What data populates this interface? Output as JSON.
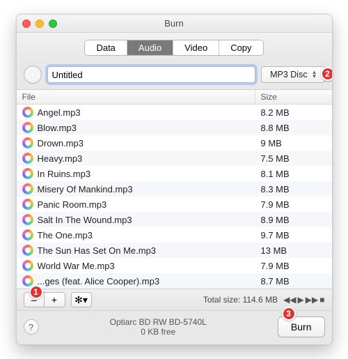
{
  "window": {
    "title": "Burn"
  },
  "tabs": {
    "items": [
      "Data",
      "Audio",
      "Video",
      "Copy"
    ],
    "active_index": 1
  },
  "disc": {
    "name_value": "Untitled",
    "type_label": "MP3 Disc"
  },
  "columns": {
    "file": "File",
    "size": "Size"
  },
  "files": [
    {
      "name": "Angel.mp3",
      "size": "8.2 MB"
    },
    {
      "name": "Blow.mp3",
      "size": "8.8 MB"
    },
    {
      "name": "Drown.mp3",
      "size": "9 MB"
    },
    {
      "name": "Heavy.mp3",
      "size": "7.5 MB"
    },
    {
      "name": "In Ruins.mp3",
      "size": "8.1 MB"
    },
    {
      "name": "Misery Of Mankind.mp3",
      "size": "8.3 MB"
    },
    {
      "name": "Panic Room.mp3",
      "size": "7.9 MB"
    },
    {
      "name": "Salt In The Wound.mp3",
      "size": "8.9 MB"
    },
    {
      "name": "The One.mp3",
      "size": "9.7 MB"
    },
    {
      "name": "The Sun Has Set On Me.mp3",
      "size": "13 MB"
    },
    {
      "name": "World War Me.mp3",
      "size": "7.9 MB"
    },
    {
      "name": "...ges (feat. Alice Cooper).mp3",
      "size": "8.7 MB"
    }
  ],
  "total": {
    "label": "Total size:",
    "value": "114.6 MB"
  },
  "media_icons": {
    "prev": "◀◀",
    "play": "▶",
    "next": "▶▶",
    "stop": "■"
  },
  "toolbar": {
    "remove": "–",
    "add": "+",
    "gear": "✻▾"
  },
  "help": "?",
  "drive": {
    "name": "Optiarc BD RW BD-5740L",
    "free": "0 KB free"
  },
  "burn": {
    "label": "Burn"
  },
  "callouts": {
    "one": "1",
    "two": "2",
    "three": "3"
  }
}
